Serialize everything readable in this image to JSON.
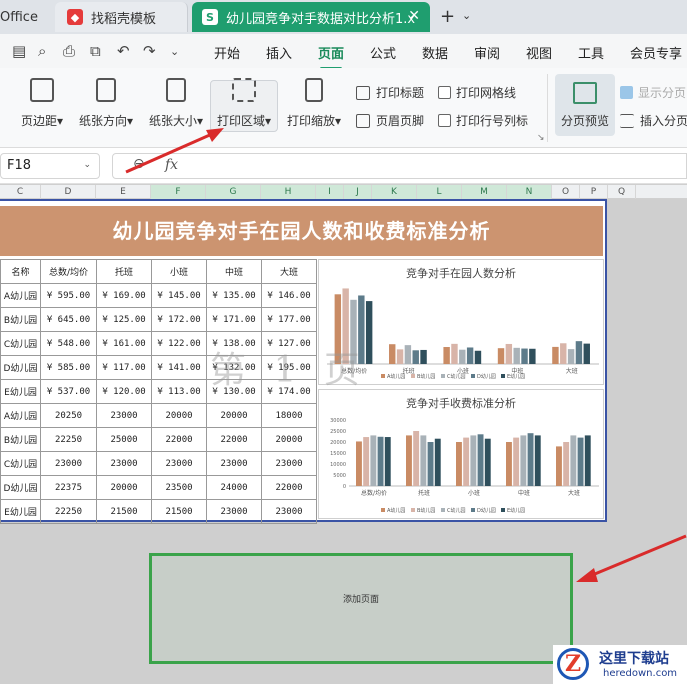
{
  "tabs": {
    "office": "Office",
    "template": "找稻壳模板",
    "file": "幼儿园竞争对手数据对比分析1.xls"
  },
  "menu": {
    "items": [
      "开始",
      "插入",
      "页面",
      "公式",
      "数据",
      "审阅",
      "视图",
      "工具",
      "会员专享"
    ],
    "active": "页面"
  },
  "ribbon": {
    "margins_left": "距",
    "margins": "页边距",
    "orientation": "纸张方向",
    "size": "纸张大小",
    "print_area": "打印区域",
    "print_scale": "打印缩放",
    "print_titles": "打印标题",
    "header_footer": "页眉页脚",
    "print_gridlines": "打印网格线",
    "print_row_col": "打印行号列标",
    "page_break_preview": "分页预览",
    "show_page_breaks": "显示分页",
    "insert_page_break": "插入分页"
  },
  "formula_bar": {
    "name_box": "F18",
    "fx": "fx"
  },
  "columns": [
    "C",
    "D",
    "E",
    "F",
    "G",
    "H",
    "I",
    "J",
    "K",
    "L",
    "M",
    "N",
    "O",
    "P",
    "Q"
  ],
  "sheet": {
    "title": "幼儿园竞争对手在园人数和收费标准分析",
    "header": [
      "名称",
      "总数/均价",
      "托班",
      "小班",
      "中班",
      "大班"
    ],
    "fee_rows": [
      [
        "A幼儿园",
        "¥ 595.00",
        "¥ 169.00",
        "¥ 145.00",
        "¥ 135.00",
        "¥ 146.00"
      ],
      [
        "B幼儿园",
        "¥ 645.00",
        "¥ 125.00",
        "¥ 172.00",
        "¥ 171.00",
        "¥ 177.00"
      ],
      [
        "C幼儿园",
        "¥ 548.00",
        "¥ 161.00",
        "¥ 122.00",
        "¥ 138.00",
        "¥ 127.00"
      ],
      [
        "D幼儿园",
        "¥ 585.00",
        "¥ 117.00",
        "¥ 141.00",
        "¥ 132.00",
        "¥ 195.00"
      ],
      [
        "E幼儿园",
        "¥ 537.00",
        "¥ 120.00",
        "¥ 113.00",
        "¥ 130.00",
        "¥ 174.00"
      ]
    ],
    "count_rows": [
      [
        "A幼儿园",
        "20250",
        "23000",
        "20000",
        "20000",
        "18000"
      ],
      [
        "B幼儿园",
        "22250",
        "25000",
        "22000",
        "22000",
        "20000"
      ],
      [
        "C幼儿园",
        "23000",
        "23000",
        "23000",
        "23000",
        "23000"
      ],
      [
        "D幼儿园",
        "22375",
        "20000",
        "23500",
        "24000",
        "22000"
      ],
      [
        "E幼儿园",
        "22250",
        "21500",
        "21500",
        "23000",
        "23000"
      ]
    ],
    "watermark": "第 1 页"
  },
  "chart_data": [
    {
      "type": "bar",
      "title": "竞争对手在园人数分析",
      "categories": [
        "总数/均价",
        "托班",
        "小班",
        "中班",
        "大班"
      ],
      "series": [
        {
          "name": "A幼儿园",
          "values": [
            595,
            169,
            145,
            135,
            146
          ]
        },
        {
          "name": "B幼儿园",
          "values": [
            645,
            125,
            172,
            171,
            177
          ]
        },
        {
          "name": "C幼儿园",
          "values": [
            548,
            161,
            122,
            138,
            127
          ]
        },
        {
          "name": "D幼儿园",
          "values": [
            585,
            117,
            141,
            132,
            195
          ]
        },
        {
          "name": "E幼儿园",
          "values": [
            537,
            120,
            113,
            130,
            174
          ]
        }
      ],
      "ylim": [
        0,
        700
      ],
      "legend": "bottom",
      "grid": false
    },
    {
      "type": "bar",
      "title": "竞争对手收费标准分析",
      "categories": [
        "总数/均价",
        "托班",
        "小班",
        "中班",
        "大班"
      ],
      "series": [
        {
          "name": "A幼儿园",
          "values": [
            20250,
            23000,
            20000,
            20000,
            18000
          ]
        },
        {
          "name": "B幼儿园",
          "values": [
            22250,
            25000,
            22000,
            22000,
            20000
          ]
        },
        {
          "name": "C幼儿园",
          "values": [
            23000,
            23000,
            23000,
            23000,
            23000
          ]
        },
        {
          "name": "D幼儿园",
          "values": [
            22375,
            20000,
            23500,
            24000,
            22000
          ]
        },
        {
          "name": "E幼儿园",
          "values": [
            22250,
            21500,
            21500,
            23000,
            23000
          ]
        }
      ],
      "yticks": [
        "0",
        "5000",
        "10000",
        "15000",
        "20000",
        "25000",
        "30000"
      ],
      "ylim": [
        0,
        30000
      ],
      "legend": "bottom",
      "grid": false
    }
  ],
  "series_colors": [
    "#c98b64",
    "#d8b4a8",
    "#a9b2b8",
    "#5d7b8a",
    "#2f4f5c"
  ],
  "add_page": "添加页面",
  "logo": {
    "mark": "Z",
    "name": "这里下载站",
    "domain": "heredown.com"
  },
  "colors": {
    "accent": "#1f9e6f",
    "page_border": "#3a53a5",
    "title_band": "#cc9470",
    "annotation_arrow": "#d92b2b",
    "add_page_border": "#3aa34a"
  }
}
